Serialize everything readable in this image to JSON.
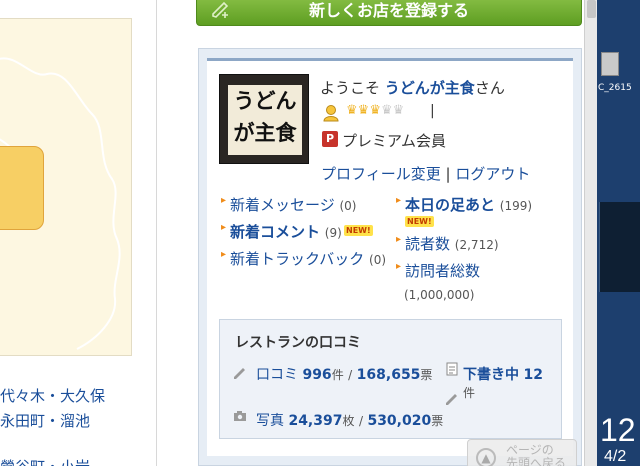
{
  "header": {
    "register_button": "新しくお店を登録する"
  },
  "sidebar": {
    "areas": [
      "代々木・大久保",
      "永田町・溜池",
      "鶯谷町・小岩"
    ]
  },
  "profile": {
    "welcome_prefix": "ようこそ",
    "user_name": "うどんが主食",
    "welcome_suffix": "さん",
    "separator": "|",
    "membership": "プレミアム会員",
    "membership_icon": "premium-icon",
    "avatar_text_1": "うどん",
    "avatar_text_2": "が主食",
    "rating": {
      "filled": 3,
      "total": 5
    },
    "edit_profile": "プロフィール変更",
    "link_separator": "|",
    "logout": "ログアウト"
  },
  "stats": {
    "new_messages": {
      "label": "新着メッセージ",
      "count": "(0)"
    },
    "new_comments": {
      "label": "新着コメント",
      "count": "(9)",
      "badge": "NEW!"
    },
    "new_trackbacks": {
      "label": "新着トラックバック",
      "count": "(0)"
    },
    "today_footprints": {
      "label": "本日の足あと",
      "count": "(199)",
      "badge": "NEW!"
    },
    "readers": {
      "label": "読者数",
      "count": "(2,712)"
    },
    "total_visitors": {
      "label": "訪問者総数",
      "count": "(1,000,000)"
    }
  },
  "reviews": {
    "title": "レストランの口コミ",
    "reviews_label": "口コミ",
    "reviews_count": "996",
    "reviews_unit": "件",
    "reviews_votes_sep": "/",
    "reviews_votes": "168,655",
    "votes_unit": "票",
    "drafts_label": "下書き中",
    "drafts_count": "12",
    "drafts_unit": "件",
    "photos_label": "写真",
    "photos_count": "24,397",
    "photos_unit": "枚",
    "photos_votes_sep": "/",
    "photos_votes": "530,020",
    "photos_votes_unit": "票"
  },
  "page_top": {
    "line1": "ページの",
    "line2": "先頭へ戻る"
  },
  "desktop": {
    "icon_label": "C_2615",
    "clock_time": "12",
    "clock_date": "4/2"
  },
  "colors": {
    "link": "#1a4e9a",
    "register_green": "#6aa82a",
    "accent_orange": "#f08c1a",
    "star_gold": "#f0b323"
  }
}
